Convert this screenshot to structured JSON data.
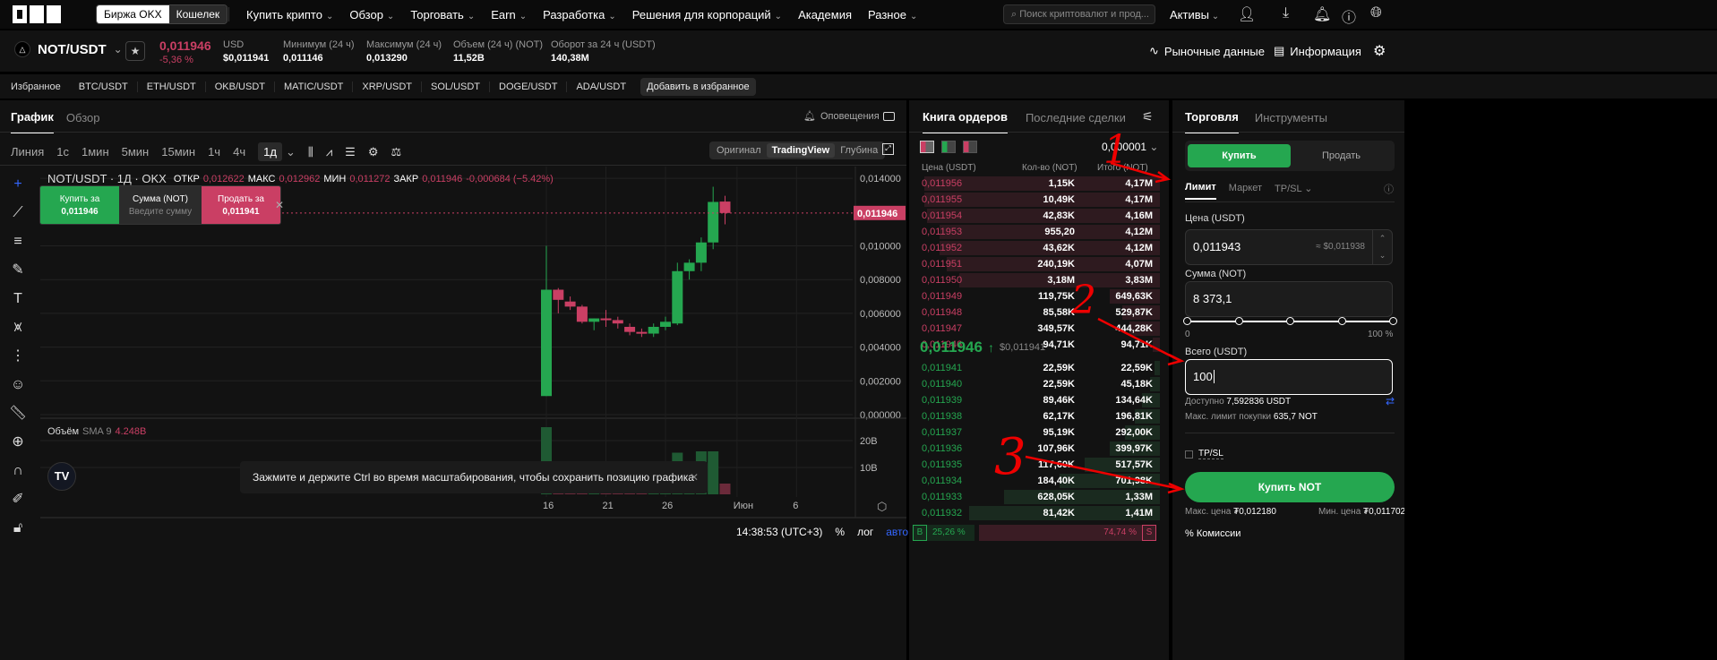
{
  "nav": {
    "exchange_tab": "Биржа OKX",
    "wallet_tab": "Кошелек",
    "items": [
      "Купить крипто",
      "Обзор",
      "Торговать",
      "Earn",
      "Разработка",
      "Решения для корпораций",
      "Академия",
      "Разное"
    ],
    "search_placeholder": "Поиск криптовалют и прод...",
    "assets": "Активы"
  },
  "ticker": {
    "pair": "NOT/USDT",
    "price": "0,011946",
    "change": "-5,36 %",
    "stats": [
      {
        "label": "USD",
        "value": "$0,011941"
      },
      {
        "label": "Минимум (24 ч)",
        "value": "0,011146"
      },
      {
        "label": "Максимум (24 ч)",
        "value": "0,013290"
      },
      {
        "label": "Объем (24 ч) (NOT)",
        "value": "11,52B"
      },
      {
        "label": "Оборот за 24 ч (USDT)",
        "value": "140,38M"
      }
    ],
    "market_data": "Рыночные данные",
    "info": "Информация"
  },
  "favorites": {
    "label": "Избранное",
    "pairs": [
      "BTC/USDT",
      "ETH/USDT",
      "OKB/USDT",
      "MATIC/USDT",
      "XRP/USDT",
      "SOL/USDT",
      "DOGE/USDT",
      "ADA/USDT"
    ],
    "add": "Добавить в избранное"
  },
  "chart": {
    "tabs": [
      "График",
      "Обзор"
    ],
    "alerts": "Оповещения",
    "timeframes": [
      "Линия",
      "1с",
      "1мин",
      "5мин",
      "15мин",
      "1ч",
      "4ч",
      "1д"
    ],
    "views": [
      "Оригинал",
      "TradingView",
      "Глубина"
    ],
    "legend": {
      "title": "NOT/USDT · 1Д · OKX",
      "open_l": "ОТКР",
      "open": "0,012622",
      "high_l": "МАКС",
      "high": "0,012962",
      "low_l": "МИН",
      "low": "0,011272",
      "close_l": "ЗАКР",
      "close": "0,011946",
      "chg": "-0,000684 (−5.42%)"
    },
    "quick": {
      "buy_l": "Купить за",
      "buy": "0,011946",
      "amt_l": "Сумма (NOT)",
      "amt_ph": "Введите сумму",
      "sell_l": "Продать за",
      "sell": "0,011941"
    },
    "volume_legend": {
      "label": "Объём",
      "sma": "SMA 9",
      "value": "4.248B"
    },
    "tooltip": "Зажмите и держите Ctrl во время масштабирования, чтобы сохранить позицию графика",
    "time": "14:38:53 (UTC+3)",
    "pct": "%",
    "log": "лог",
    "auto": "авто"
  },
  "chart_data": {
    "type": "candlestick",
    "price_ticks": [
      "0,014000",
      "0,010000",
      "0,008000",
      "0,006000",
      "0,004000",
      "0,002000",
      "0,000000"
    ],
    "price_tick_values": [
      0.014,
      0.01,
      0.008,
      0.006,
      0.004,
      0.002,
      0
    ],
    "last_price_label": "0,011946",
    "last_price": 0.011946,
    "volume_ticks": [
      "20B",
      "10B"
    ],
    "volume_tick_values": [
      20,
      10
    ],
    "x_labels": [
      {
        "label": "16",
        "i": 0
      },
      {
        "label": "21",
        "i": 5
      },
      {
        "label": "26",
        "i": 10
      },
      {
        "label": "Июн",
        "i": 16
      },
      {
        "label": "6",
        "i": 21
      }
    ],
    "candles": [
      [
        0.0011,
        0.01,
        0.0011,
        0.0074
      ],
      [
        0.0074,
        0.0075,
        0.006,
        0.0068
      ],
      [
        0.0067,
        0.007,
        0.0062,
        0.0064
      ],
      [
        0.0064,
        0.0065,
        0.0054,
        0.0055
      ],
      [
        0.0055,
        0.0057,
        0.005,
        0.0057
      ],
      [
        0.0057,
        0.0062,
        0.0052,
        0.0056
      ],
      [
        0.0056,
        0.0058,
        0.0051,
        0.0054
      ],
      [
        0.0052,
        0.0054,
        0.0047,
        0.0049
      ],
      [
        0.0049,
        0.0051,
        0.0046,
        0.0048
      ],
      [
        0.0048,
        0.0054,
        0.0046,
        0.0052
      ],
      [
        0.0052,
        0.0058,
        0.005,
        0.0055
      ],
      [
        0.0054,
        0.009,
        0.0053,
        0.0085
      ],
      [
        0.0085,
        0.0092,
        0.008,
        0.009
      ],
      [
        0.009,
        0.0105,
        0.0085,
        0.0102
      ],
      [
        0.0102,
        0.0135,
        0.0098,
        0.0126
      ],
      [
        0.012622,
        0.012962,
        0.011272,
        0.011946
      ]
    ],
    "volumes": [
      25,
      1.5,
      1.2,
      1.3,
      1.5,
      1.2,
      1.1,
      1.3,
      1.2,
      1.8,
      3,
      15.5,
      12,
      16,
      16,
      4
    ]
  },
  "orderbook": {
    "tabs": [
      "Книга ордеров",
      "Последние сделки"
    ],
    "step": "0,000001",
    "headers": [
      "Цена (USDT)",
      "Кол-во (NOT)",
      "Итого (NOT)"
    ],
    "asks": [
      [
        "0,011956",
        "1,15K",
        "4,17M",
        0.94
      ],
      [
        "0,011955",
        "10,49K",
        "4,17M",
        0.94
      ],
      [
        "0,011954",
        "42,83K",
        "4,16M",
        0.93
      ],
      [
        "0,011953",
        "955,20",
        "4,12M",
        0.88
      ],
      [
        "0,011952",
        "43,62K",
        "4,12M",
        0.88
      ],
      [
        "0,011951",
        "240,19K",
        "4,07M",
        0.85
      ],
      [
        "0,011950",
        "3,18M",
        "3,83M",
        0.8
      ],
      [
        "0,011949",
        "119,75K",
        "649,63K",
        0.2
      ],
      [
        "0,011948",
        "85,58K",
        "529,87K",
        0.15
      ],
      [
        "0,011947",
        "349,57K",
        "444,28K",
        0.12
      ],
      [
        "0,011946",
        "94,71K",
        "94,71K",
        0.03
      ]
    ],
    "mid_price": "0,011946",
    "mid_usd": "$0,011941",
    "bids": [
      [
        "0,011941",
        "22,59K",
        "22,59K",
        0.02
      ],
      [
        "0,011940",
        "22,59K",
        "45,18K",
        0.04
      ],
      [
        "0,011939",
        "89,46K",
        "134,64K",
        0.07
      ],
      [
        "0,011938",
        "62,17K",
        "196,81K",
        0.1
      ],
      [
        "0,011937",
        "95,19K",
        "292,00K",
        0.14
      ],
      [
        "0,011936",
        "107,96K",
        "399,97K",
        0.2
      ],
      [
        "0,011935",
        "117,60K",
        "517,57K",
        0.3
      ],
      [
        "0,011934",
        "184,40K",
        "701,98K",
        0.4
      ],
      [
        "0,011933",
        "628,05K",
        "1,33M",
        0.62
      ],
      [
        "0,011932",
        "81,42K",
        "1,41M",
        0.76
      ]
    ],
    "buy_label": "B",
    "buy_pct": "25,26 %",
    "sell_pct": "74,74 %",
    "sell_label": "S",
    "buy_ratio": 0.2526
  },
  "trade": {
    "tabs": [
      "Торговля",
      "Инструменты"
    ],
    "buy": "Купить",
    "sell": "Продать",
    "order_types": [
      "Лимит",
      "Маркет",
      "TP/SL"
    ],
    "price_label": "Цена (USDT)",
    "price": "0,011943",
    "price_usd": "≈ $0,011938",
    "amount_label": "Сумма (NOT)",
    "amount": "8 373,1",
    "slider_min": "0",
    "slider_max": "100 %",
    "slider_value": 1.0,
    "total_label": "Всего (USDT)",
    "total": "100",
    "avail_l": "Доступно",
    "avail": "7,592836 USDT",
    "maxbuy_l": "Макс. лимит покупки",
    "maxbuy": "635,7 NOT",
    "tpsl": "TP/SL",
    "submit": "Купить NOT",
    "maxprice_l": "Макс. цена",
    "maxprice": "₮0,012180",
    "minprice_l": "Мин. цена",
    "minprice": "₮0,011702",
    "fees": "Комиссии",
    "fees_icon": "%"
  },
  "annotations": [
    "1",
    "2",
    "3"
  ],
  "colors": {
    "up": "#25a750",
    "down": "#ca3f64",
    "bg": "#121212"
  }
}
